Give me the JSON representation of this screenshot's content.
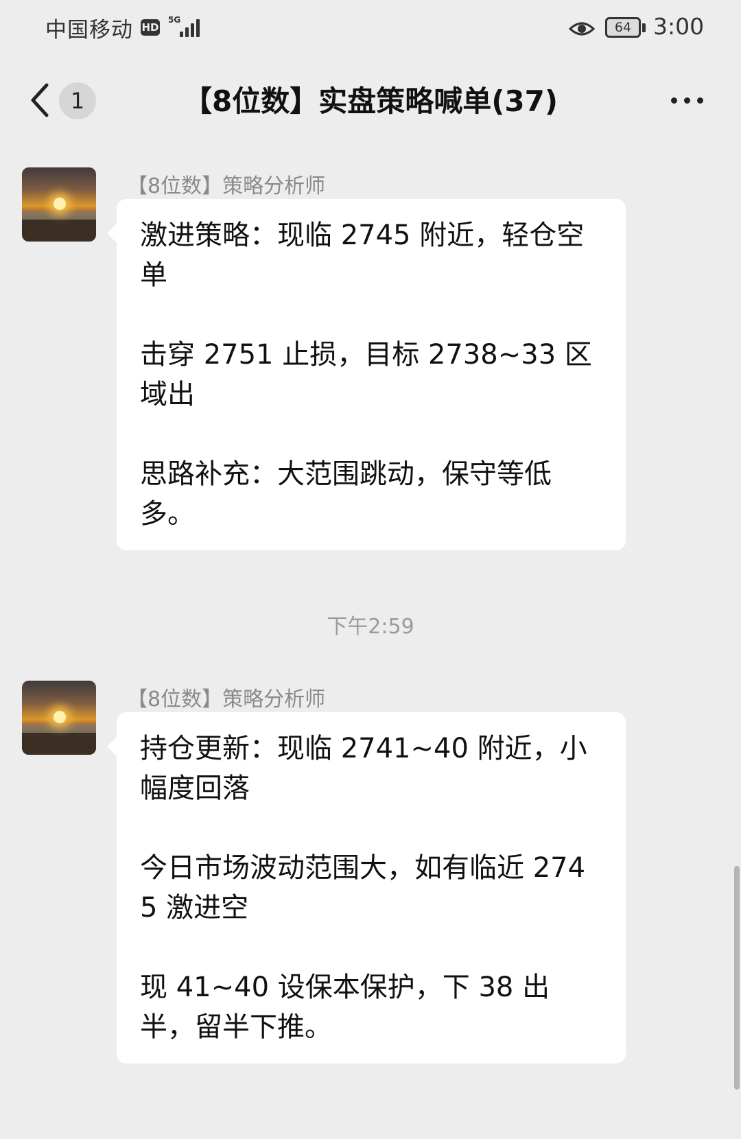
{
  "status_bar": {
    "carrier": "中国移动",
    "hd": "HD",
    "network": "5G",
    "battery": "64",
    "time": "3:00"
  },
  "nav": {
    "unread": "1",
    "title": "【8位数】实盘策略喊单(37)"
  },
  "messages": [
    {
      "sender": "【8位数】策略分析师",
      "paragraphs": [
        "激进策略：现临 2745 附近，轻仓空单",
        "击穿 2751 止损，目标 2738~33 区域出",
        "思路补充：大范围跳动，保守等低多。"
      ]
    },
    {
      "sender": "【8位数】策略分析师",
      "paragraphs": [
        "持仓更新：现临 2741~40 附近，小幅度回落",
        "今日市场波动范围大，如有临近 2745 激进空",
        "现 41~40 设保本保护，下 38 出半，留半下推。"
      ]
    }
  ],
  "timestamp": "下午2:59",
  "icons": {
    "back": "chevron-left-icon",
    "more": "more-dots-icon",
    "eye": "eye-icon"
  }
}
